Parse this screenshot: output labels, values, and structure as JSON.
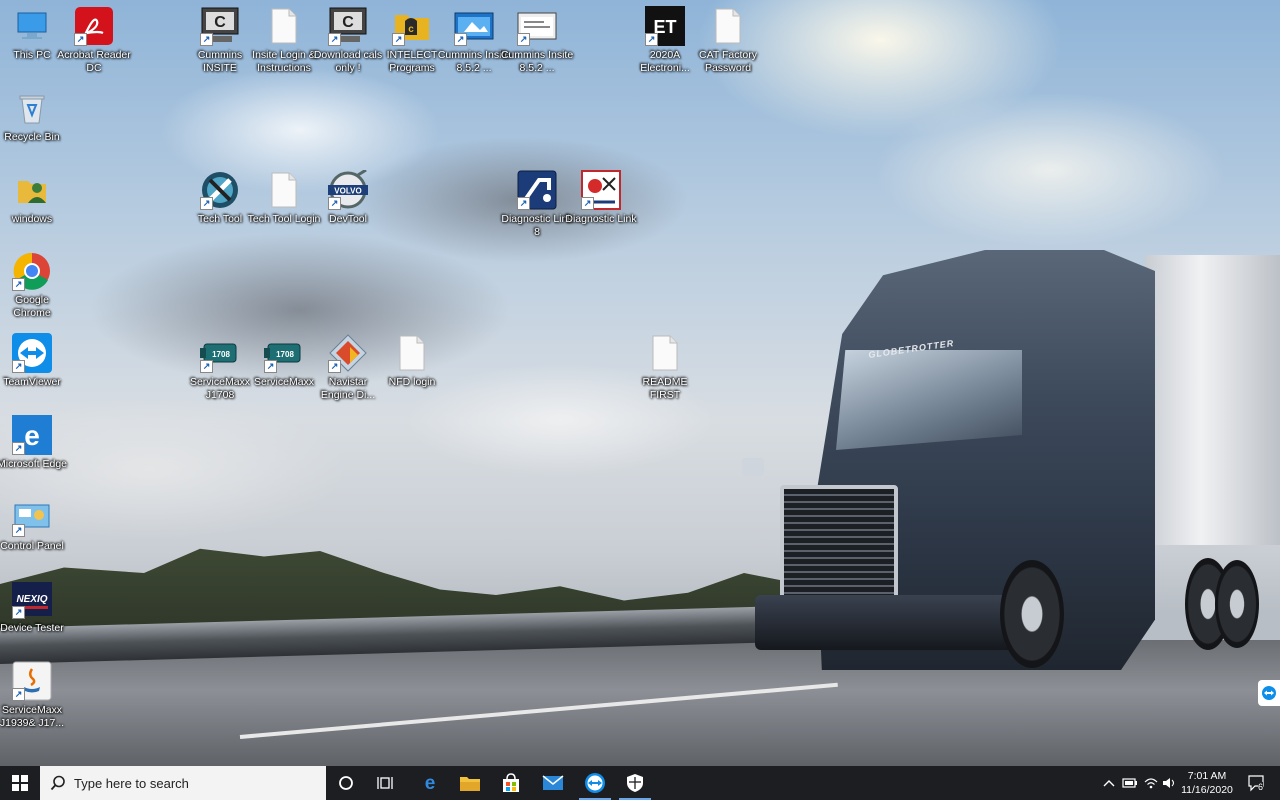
{
  "desktop": {
    "icons": [
      {
        "id": "this-pc",
        "label": "This PC"
      },
      {
        "id": "acrobat",
        "label": "Acrobat Reader DC"
      },
      {
        "id": "cummins-insite",
        "label": "Cummins INSITE"
      },
      {
        "id": "insite-login",
        "label": "Insite Login & Instructions"
      },
      {
        "id": "download-cals",
        "label": "Download cals only !"
      },
      {
        "id": "intelect",
        "label": "INTELECT Programs"
      },
      {
        "id": "cummins-insite-852a",
        "label": "Cummins Insite 8.5.2 ..."
      },
      {
        "id": "cummins-insite-852b",
        "label": "Cummins Insite 8.5.2 ..."
      },
      {
        "id": "et-2020a",
        "label": "2020A Electroni..."
      },
      {
        "id": "cat-factory",
        "label": "CAT Factory Password"
      },
      {
        "id": "recycle-bin",
        "label": "Recycle Bin"
      },
      {
        "id": "windows",
        "label": "windows"
      },
      {
        "id": "tech-tool",
        "label": "Tech Tool"
      },
      {
        "id": "tech-tool-login",
        "label": "Tech Tool Login"
      },
      {
        "id": "devtool",
        "label": "DevTool"
      },
      {
        "id": "diag-link-8",
        "label": "Diagnostic Link 8"
      },
      {
        "id": "diag-link",
        "label": "Diagnostic Link"
      },
      {
        "id": "chrome",
        "label": "Google Chrome"
      },
      {
        "id": "teamviewer",
        "label": "TeamViewer"
      },
      {
        "id": "servicemaxx-j1708",
        "label": "ServiceMaxx J1708"
      },
      {
        "id": "servicemaxx",
        "label": "ServiceMaxx"
      },
      {
        "id": "navistar",
        "label": "Navistar Engine Di..."
      },
      {
        "id": "nfd-login",
        "label": "NFD login"
      },
      {
        "id": "readme",
        "label": "README FIRST"
      },
      {
        "id": "edge",
        "label": "Microsoft Edge"
      },
      {
        "id": "control-panel",
        "label": "Control Panel"
      },
      {
        "id": "device-tester",
        "label": "Device Tester"
      },
      {
        "id": "servicemaxx-j1939",
        "label": "ServiceMaxx J1939& J17..."
      }
    ],
    "icon_glyphs": {
      "et": "ET",
      "nexiq": "NEXIQ",
      "volvo": "VOLVO",
      "sm": "1708"
    },
    "wallpaper_text": "GLOBETROTTER"
  },
  "taskbar": {
    "search_placeholder": "Type here to search",
    "clock_time": "7:01 AM",
    "clock_date": "11/16/2020",
    "notification_count": "6",
    "accent": "#0078d7"
  }
}
